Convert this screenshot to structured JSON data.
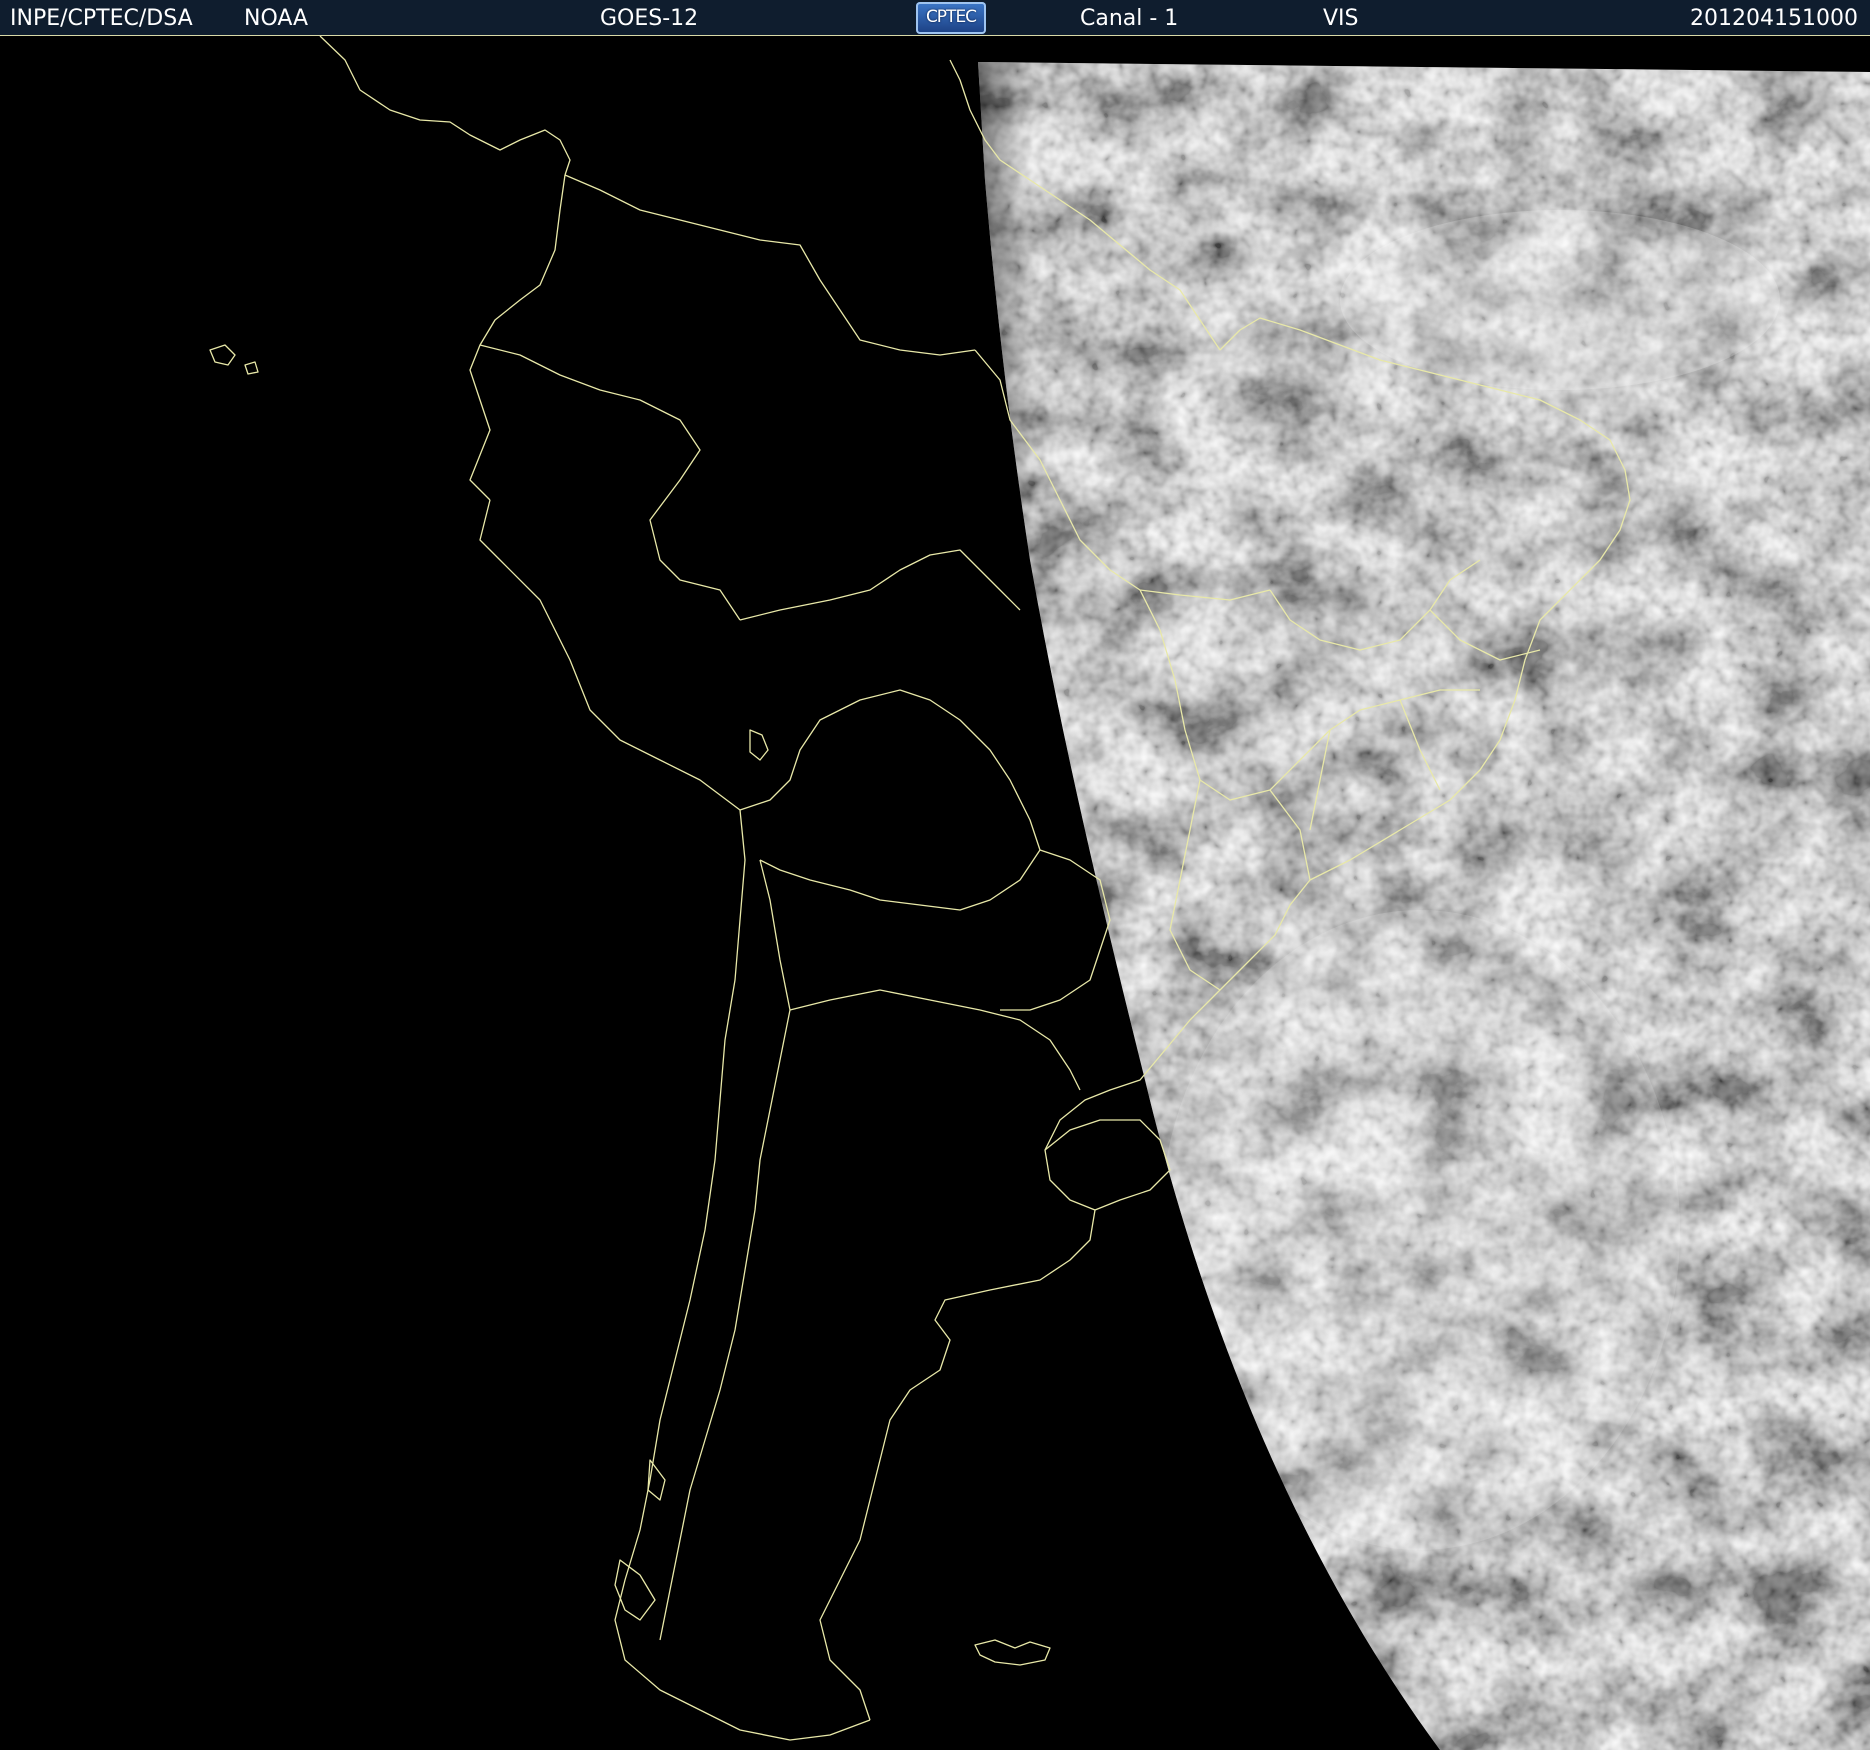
{
  "header": {
    "institution": "INPE/CPTEC/DSA",
    "agency": "NOAA",
    "satellite": "GOES-12",
    "logo_text": "CPTEC",
    "channel": "Canal - 1",
    "band": "VIS",
    "timestamp": "201204151000"
  },
  "colors": {
    "header_background": "#0f1d2e",
    "map_background": "#000000",
    "coastline": "#e8e8a8",
    "cloud_bright": "#f0f0f0",
    "cloud_dark": "#5a5a5a"
  }
}
